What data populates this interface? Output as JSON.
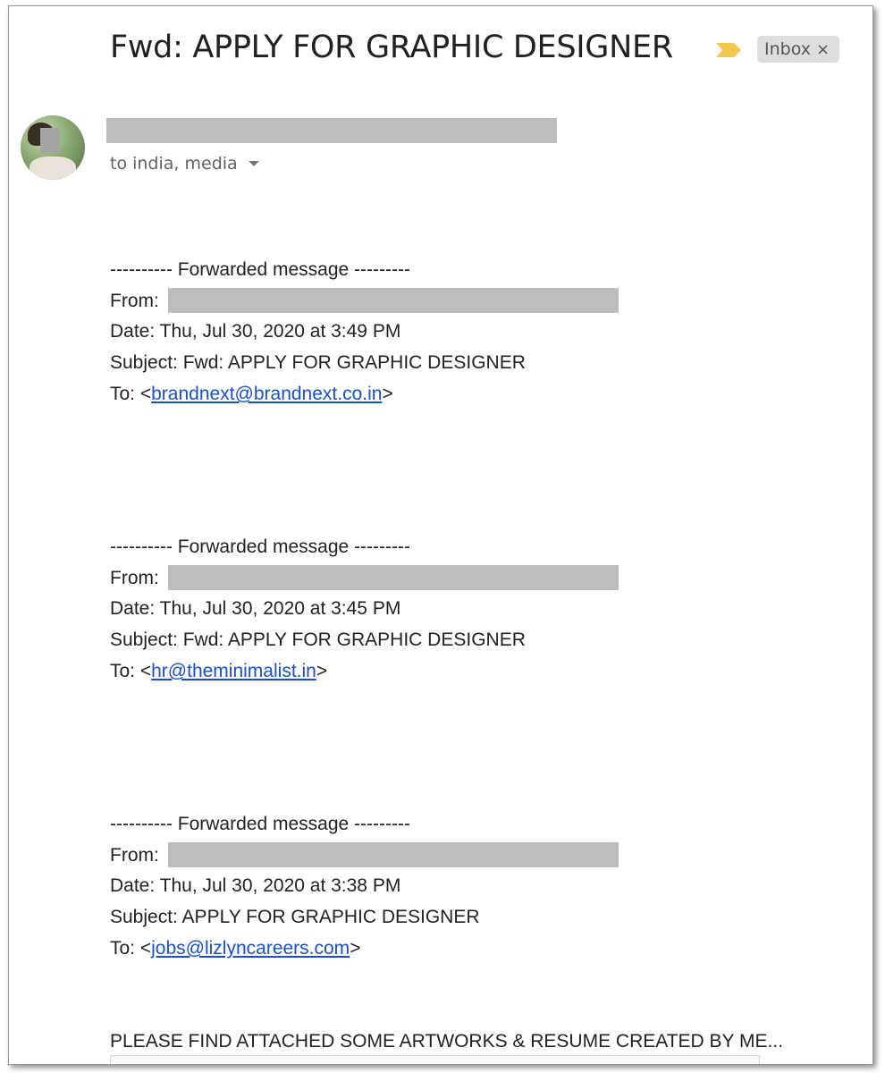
{
  "email": {
    "subject": "Fwd: APPLY FOR GRAPHIC DESIGNER",
    "label": "Inbox",
    "label_close": "×",
    "recipients": "to india, media"
  },
  "forwards": [
    {
      "header": "---------- Forwarded message ---------",
      "from_label": "From:",
      "date": "Date: Thu, Jul 30, 2020 at 3:49 PM",
      "subject": "Subject: Fwd: APPLY FOR GRAPHIC DESIGNER",
      "to_prefix": "To: <",
      "to_email": "brandnext@brandnext.co.in",
      "to_suffix": ">"
    },
    {
      "header": "---------- Forwarded message ---------",
      "from_label": "From:",
      "date": "Date: Thu, Jul 30, 2020 at 3:45 PM",
      "subject": "Subject: Fwd: APPLY FOR GRAPHIC DESIGNER",
      "to_prefix": "To: <",
      "to_email": "hr@theminimalist.in",
      "to_suffix": ">"
    },
    {
      "header": "---------- Forwarded message ---------",
      "from_label": "From:",
      "date": "Date: Thu, Jul 30, 2020 at 3:38 PM",
      "subject": "Subject: APPLY FOR GRAPHIC DESIGNER",
      "to_prefix": "To: <",
      "to_email": "jobs@lizlyncareers.com",
      "to_suffix": ">"
    }
  ],
  "body_text": "PLEASE FIND ATTACHED SOME ARTWORKS & RESUME CREATED BY ME...",
  "colors": {
    "important_marker": "#f2c94c",
    "link": "#1a4fcc",
    "redaction": "#bdbdbd"
  },
  "icons": {
    "important": "importance-marker-icon",
    "dropdown": "chevron-down-icon",
    "chip_close": "close-icon"
  }
}
